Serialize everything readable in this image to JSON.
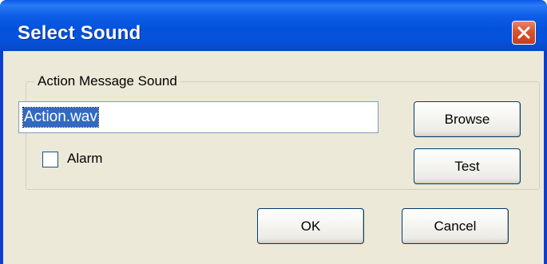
{
  "window": {
    "title": "Select Sound",
    "close_icon": "close-icon"
  },
  "group": {
    "label": "Action Message Sound",
    "sound_file_value": "Action.wav",
    "alarm_label": "Alarm",
    "alarm_checked": false
  },
  "buttons": {
    "browse": "Browse",
    "test": "Test",
    "ok": "OK",
    "cancel": "Cancel"
  },
  "colors": {
    "titlebar": "#0553dc",
    "dialog_background": "#ece9d8",
    "close_button": "#d9542c",
    "selection": "#316ac5"
  }
}
